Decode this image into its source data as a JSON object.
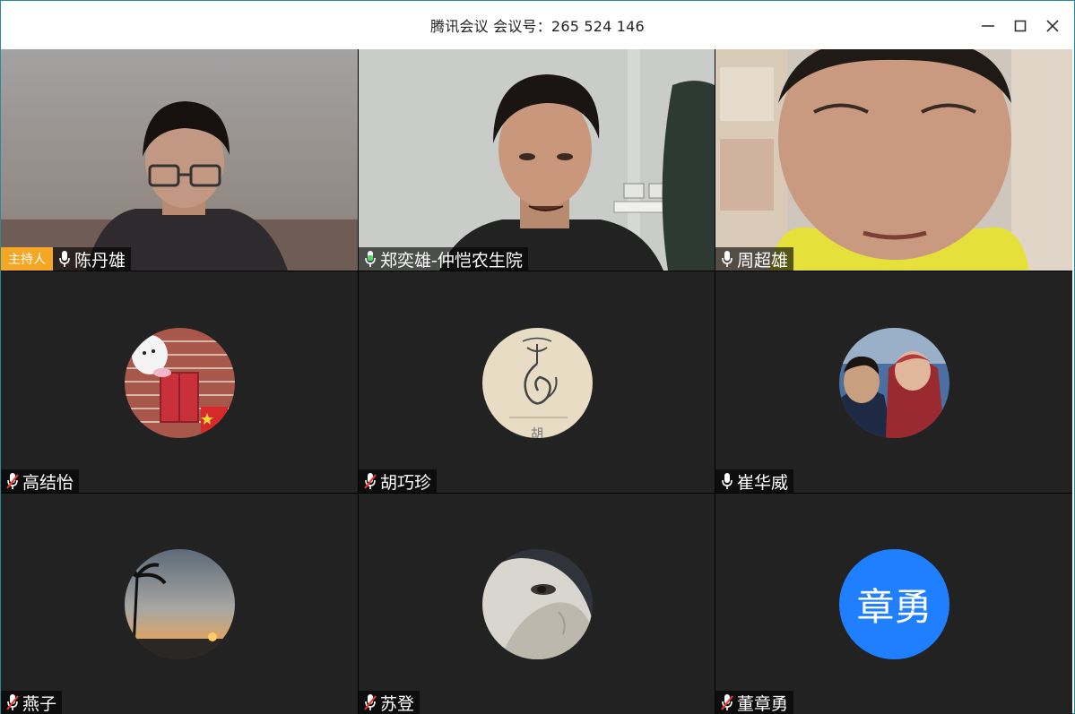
{
  "window": {
    "title": "腾讯会议 会议号：265 524 146"
  },
  "participants": [
    {
      "name": "陈丹雄",
      "role": "主持人",
      "mic": "on",
      "type": "video"
    },
    {
      "name": "郑奕雄-仲恺农生院",
      "mic": "speaking",
      "type": "video"
    },
    {
      "name": "周超雄",
      "mic": "on",
      "type": "video"
    },
    {
      "name": "高结怡",
      "mic": "muted",
      "type": "avatar",
      "avatar": "rabbit-brick-wall"
    },
    {
      "name": "胡巧珍",
      "mic": "muted",
      "type": "avatar",
      "avatar": "ink-flower",
      "avatar_char": "胡"
    },
    {
      "name": "崔华威",
      "mic": "on",
      "type": "avatar",
      "avatar": "father-child-photo"
    },
    {
      "name": "燕子",
      "mic": "muted",
      "type": "avatar",
      "avatar": "sunset-palm"
    },
    {
      "name": "苏登",
      "mic": "muted",
      "type": "avatar",
      "avatar": "cat-face"
    },
    {
      "name": "董章勇",
      "mic": "muted",
      "type": "text-avatar",
      "avatar_text": "章勇"
    }
  ],
  "colors": {
    "tile_bg": "#222222",
    "host_badge": "#f5a623",
    "speaking_mic": "#4cd964",
    "muted_mic": "#e53935",
    "text_avatar_bg": "#1f7fff"
  },
  "icons": [
    "minimize-icon",
    "maximize-icon",
    "close-icon",
    "microphone-icon",
    "microphone-muted-icon"
  ]
}
